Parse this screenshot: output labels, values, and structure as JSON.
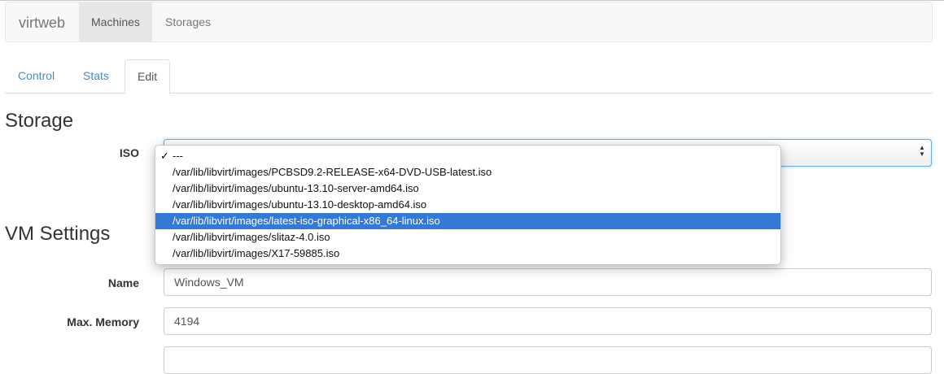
{
  "navbar": {
    "brand": "virtweb",
    "items": [
      {
        "label": "Machines",
        "active": true
      },
      {
        "label": "Storages",
        "active": false
      }
    ]
  },
  "tabs": [
    {
      "label": "Control",
      "active": false
    },
    {
      "label": "Stats",
      "active": false
    },
    {
      "label": "Edit",
      "active": true
    }
  ],
  "storage": {
    "title": "Storage",
    "iso_label": "ISO",
    "selected": "---",
    "options": [
      "---",
      "/var/lib/libvirt/images/PCBSD9.2-RELEASE-x64-DVD-USB-latest.iso",
      "/var/lib/libvirt/images/ubuntu-13.10-server-amd64.iso",
      "/var/lib/libvirt/images/ubuntu-13.10-desktop-amd64.iso",
      "/var/lib/libvirt/images/latest-iso-graphical-x86_64-linux.iso",
      "/var/lib/libvirt/images/slitaz-4.0.iso",
      "/var/lib/libvirt/images/X17-59885.iso"
    ],
    "highlighted_option": "/var/lib/libvirt/images/latest-iso-graphical-x86_64-linux.iso",
    "check_glyph": "✓"
  },
  "vm_settings": {
    "title": "VM Settings",
    "name_label": "Name",
    "name_value": "Windows_VM",
    "memory_label": "Max. Memory",
    "memory_value": "4194"
  },
  "colors": {
    "link": "#428bca",
    "highlight": "#3478d8",
    "focus_border": "#66afe9"
  }
}
